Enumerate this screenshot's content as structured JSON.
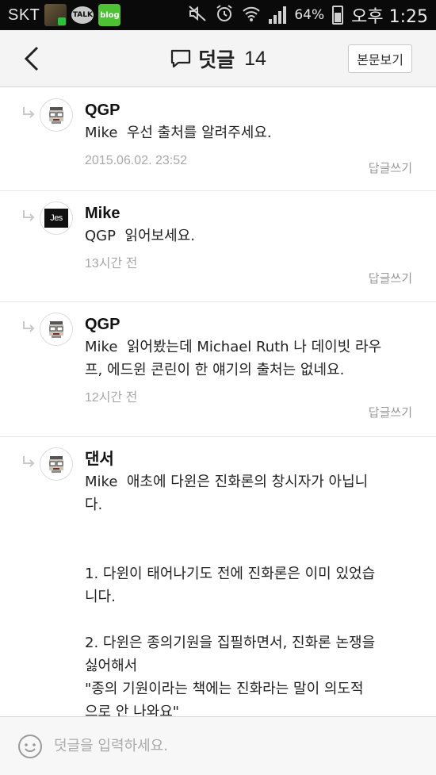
{
  "status_bar": {
    "carrier": "SKT",
    "talk_label": "TALK",
    "blog_label": "blog",
    "battery": "64%",
    "time": "오후 1:25"
  },
  "header": {
    "title": "덧글",
    "count": "14",
    "view_body_label": "본문보기"
  },
  "comments": [
    {
      "author": "QGP",
      "text": "Mike  우선 출처를 알려주세요.",
      "date": "2015.06.02. 23:52",
      "reply_label": "답글쓰기",
      "avatar": "pixel-face"
    },
    {
      "author": "Mike",
      "text": "QGP  읽어보세요.",
      "date": "13시간 전",
      "reply_label": "답글쓰기",
      "avatar": "Jes"
    },
    {
      "author": "QGP",
      "text": "Mike  읽어봤는데 Michael Ruth 나 데이빗 라우\n프, 에드윈 콘린이 한 얘기의 출처는 없네요.",
      "date": "12시간 전",
      "reply_label": "답글쓰기",
      "avatar": "pixel-face"
    },
    {
      "author": "댄서",
      "text": "Mike  애초에 다윈은 진화론의 창시자가 아닙니\n다.\n\n\n1. 다윈이 태어나기도 전에 진화론은 이미 있었습\n니다.\n\n2. 다윈은 종의기원을 집필하면서, 진화론 논쟁을\n싫어해서\n\"종의 기원이라는 책에는 진화라는 말이 의도적\n으로 안 나와요\"",
      "avatar": "pixel-face"
    }
  ],
  "input": {
    "placeholder": "덧글을 입력하세요."
  }
}
